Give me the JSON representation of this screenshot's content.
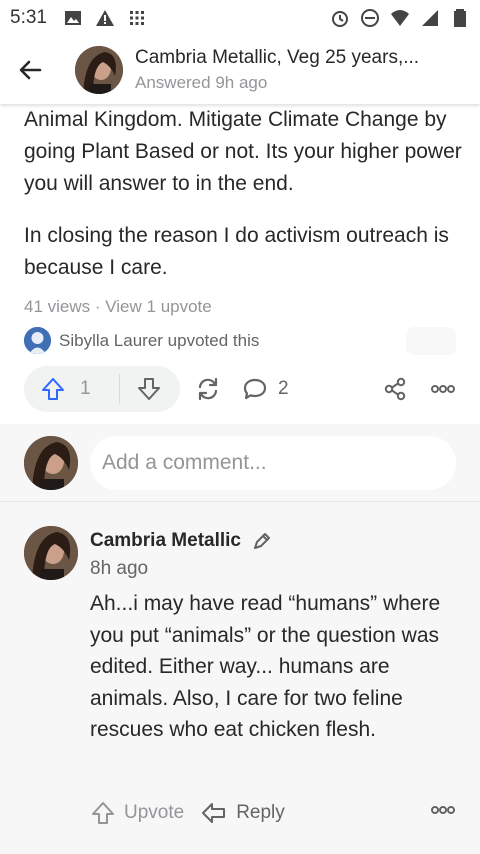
{
  "status_bar": {
    "time": "5:31"
  },
  "header": {
    "author": "Cambria Metallic, Veg 25 years,...",
    "subtitle": "Answered 9h ago"
  },
  "answer": {
    "paragraphs": [
      "Animal Kingdom. Mitigate Climate Change by going Plant Based or not. Its your higher power you will answer to in the end.",
      "In closing the reason I do activism outreach is because I care."
    ]
  },
  "stats": {
    "text": "41 views · View 1 upvote"
  },
  "upvoted_by": {
    "text": "Sibylla Laurer upvoted this"
  },
  "actions": {
    "upvote_count": "1",
    "comment_count": "2"
  },
  "add_comment": {
    "placeholder": "Add a comment..."
  },
  "comment": {
    "author": "Cambria Metallic",
    "time": "8h ago",
    "body": "Ah...i may have read “humans” where you put “animals” or the question was edited. Either way... humans are animals. Also, I care for two feline rescues who eat chicken flesh.",
    "upvote_label": "Upvote",
    "reply_label": "Reply"
  },
  "colors": {
    "text": "#282829",
    "muted": "#939598",
    "accent": "#2e69ff"
  }
}
